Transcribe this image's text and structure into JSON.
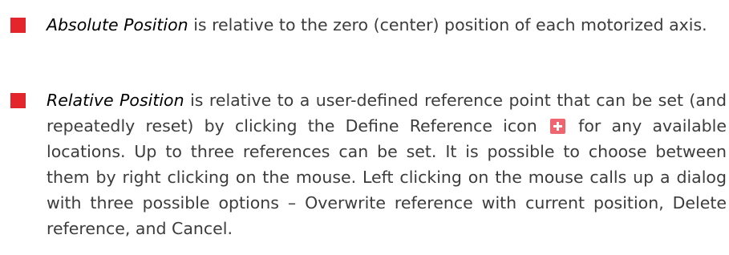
{
  "bullets": [
    {
      "term": "Absolute Position",
      "text": " is relative to the zero (center) position of each motorized axis."
    },
    {
      "term": "Relative Position",
      "text_before_icon": " is relative to a user-defined reference point that can be set (and repeatedly reset) by clicking the Define Reference icon ",
      "icon": "define-reference-plus-icon",
      "text_after_icon": " for any available locations. Up to three references can be set. It is possible to choose between them by right clicking on the mouse. Left clicking on the mouse calls up a dialog with three possible options – Overwrite reference with current position, Delete reference, and Cancel."
    }
  ],
  "colors": {
    "bullet": "#e3262b",
    "icon": "#ef6670",
    "text": "#3c3c3c"
  }
}
